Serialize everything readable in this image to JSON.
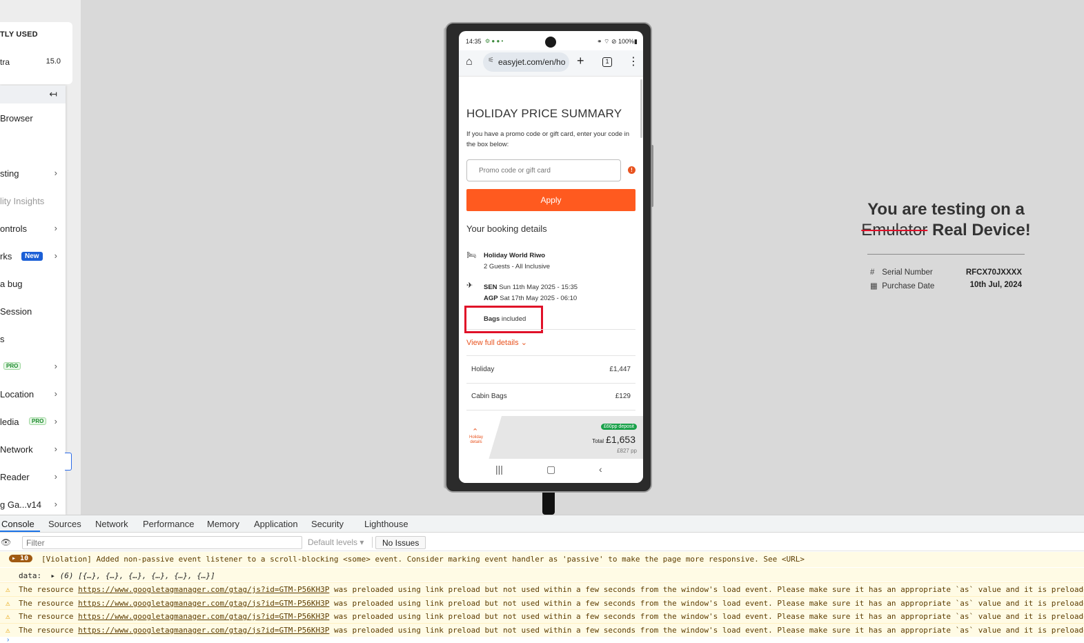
{
  "left_panel": {
    "recent_title": "TLY USED",
    "recent_row_label": "tra",
    "recent_row_version": "15.0",
    "collapse_icon": "↤",
    "items": [
      {
        "label": "Browser",
        "chevron": false
      },
      {
        "label": "sting",
        "chevron": true
      },
      {
        "label": "lity Insights",
        "chevron": false,
        "muted": true
      },
      {
        "label": "ontrols",
        "chevron": true
      },
      {
        "label": "rks",
        "chevron": true,
        "badge": "New"
      },
      {
        "label": "a bug",
        "chevron": false
      },
      {
        "label": "Session",
        "chevron": false
      },
      {
        "label": "s",
        "chevron": false
      },
      {
        "label": "",
        "chevron": true,
        "badge": "PRO"
      },
      {
        "label": "Location",
        "chevron": true
      },
      {
        "label": "ledia",
        "chevron": true,
        "badge": "PRO"
      },
      {
        "label": "Network",
        "chevron": true
      },
      {
        "label": "Reader",
        "chevron": true
      },
      {
        "label": "g Ga...v14",
        "chevron": true
      }
    ]
  },
  "phone": {
    "status_time": "14:35",
    "status_icons": "⚙ ● ● •",
    "status_battery": "⚭ ⌔ ⊘ 100%▮",
    "url": "easyjet.com/en/ho",
    "tab_count": "1",
    "page": {
      "title": "HOLIDAY PRICE SUMMARY",
      "description": "If you have a promo code or gift card, enter your code in the box below:",
      "promo_placeholder": "Promo code or gift card",
      "apply_label": "Apply",
      "booking_heading": "Your booking details",
      "hotel_name": "Holiday World Riwo",
      "hotel_guests": "2 Guests - All Inclusive",
      "flight_out_code": "SEN",
      "flight_out_time": "Sun 11th May 2025 - 15:35",
      "flight_back_code": "AGP",
      "flight_back_time": "Sat 17th May 2025 - 06:10",
      "bags_bold": "Bags",
      "bags_rest": "included",
      "view_details": "View full details",
      "price_rows": [
        {
          "name": "Holiday",
          "value": "£1,447"
        },
        {
          "name": "Cabin Bags",
          "value": "£129"
        }
      ]
    },
    "total_bar": {
      "holiday_details": "Holiday details",
      "deposit": "£60pp deposit",
      "total_label": "Total",
      "total_value": "£1,653",
      "per_person": "£827 pp"
    }
  },
  "info": {
    "line1": "You are testing on a",
    "strike_word": "Emulator",
    "line2_rest": " Real Device!",
    "serial_label": "Serial Number",
    "serial_value": "RFCX70JXXXX",
    "purchase_label": "Purchase Date",
    "purchase_value": "10th Jul, 2024"
  },
  "devtools": {
    "tabs": [
      "Console",
      "Sources",
      "Network",
      "Performance",
      "Memory",
      "Application",
      "Security",
      "Lighthouse"
    ],
    "filter_placeholder": "Filter",
    "levels": "Default levels ▾",
    "issues": "No Issues",
    "violation_count": "10",
    "violation_text": "[Violation] Added non-passive event listener to a scroll-blocking <some> event. Consider marking event handler as 'passive' to make the page more responsive. See <URL>",
    "data_label": "data:",
    "data_value": "(6) [{…}, {…}, {…}, {…}, {…}, {…}]",
    "warn_prefix": "The resource",
    "warn_url": "https://www.googletagmanager.com/gtag/js?id=GTM-P56KH3P",
    "warn_suffix": "was preloaded using link preload but not used within a few seconds from the window's load event. Please make sure it has an appropriate `as` value and it is preloaded intentionally.",
    "warn_count": 4
  }
}
